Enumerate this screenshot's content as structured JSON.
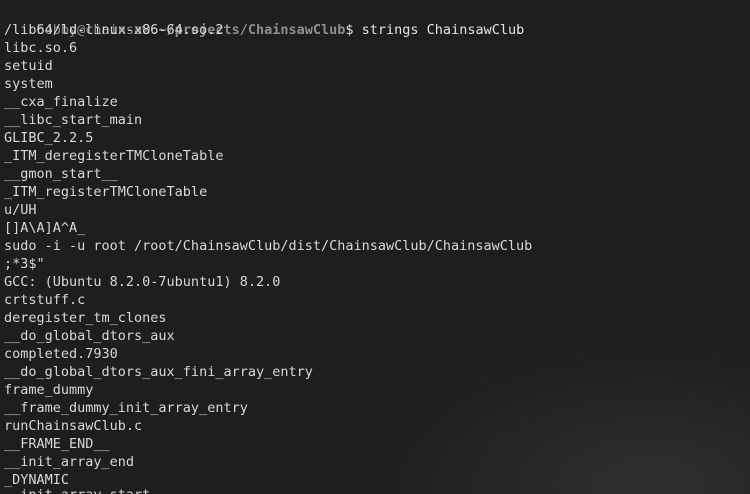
{
  "prompt": {
    "user_host": "bobby@chainsaw",
    "separator": ":",
    "path": "~/projects/ChainsawClub",
    "symbol": "$",
    "command": " strings ChainsawClub"
  },
  "output_lines": [
    "/lib64/ld-linux-x86-64.so.2",
    "libc.so.6",
    "setuid",
    "system",
    "__cxa_finalize",
    "__libc_start_main",
    "GLIBC_2.2.5",
    "_ITM_deregisterTMCloneTable",
    "__gmon_start__",
    "_ITM_registerTMCloneTable",
    "u/UH",
    "[]A\\A]A^A_",
    "sudo -i -u root /root/ChainsawClub/dist/ChainsawClub/ChainsawClub",
    ";*3$\"",
    "GCC: (Ubuntu 8.2.0-7ubuntu1) 8.2.0",
    "crtstuff.c",
    "deregister_tm_clones",
    "__do_global_dtors_aux",
    "completed.7930",
    "__do_global_dtors_aux_fini_array_entry",
    "frame_dummy",
    "__frame_dummy_init_array_entry",
    "runChainsawClub.c",
    "__FRAME_END__",
    "__init_array_end",
    "_DYNAMIC",
    "__init_array_start"
  ]
}
